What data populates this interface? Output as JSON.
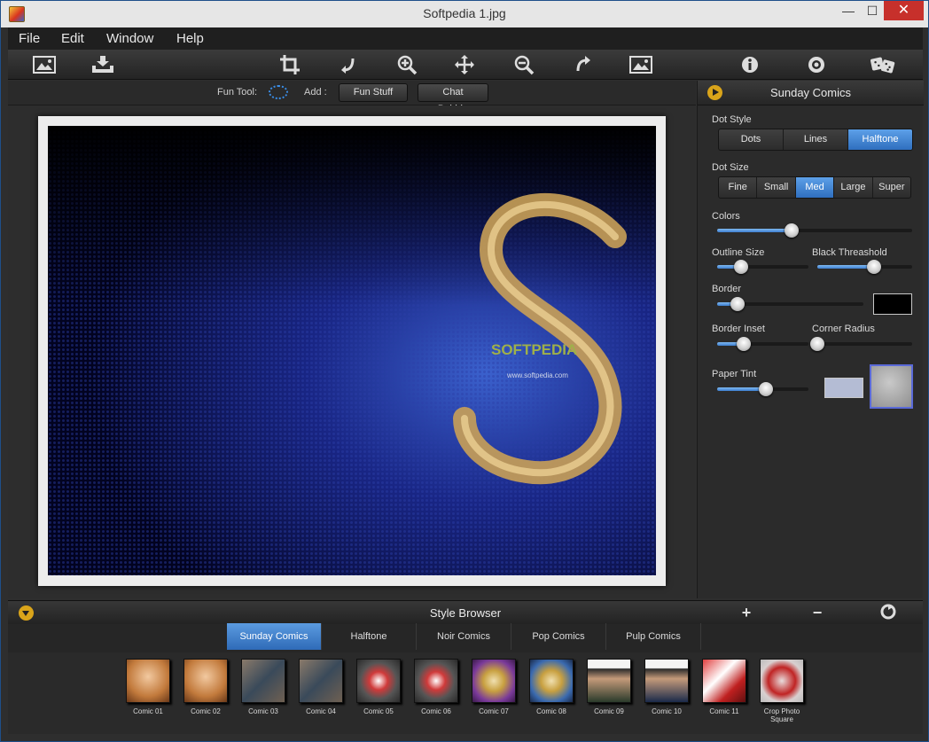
{
  "window": {
    "title": "Softpedia 1.jpg",
    "min": "—",
    "max": "☐",
    "close": "✕"
  },
  "menu": [
    "File",
    "Edit",
    "Window",
    "Help"
  ],
  "toolbar": {
    "icons": [
      "open-photo-icon",
      "save-icon",
      "crop-icon",
      "rotate-left-icon",
      "zoom-in-icon",
      "pan-icon",
      "zoom-out-icon",
      "rotate-right-icon",
      "fit-photo-icon",
      "info-icon",
      "settings-icon",
      "dice-icon"
    ]
  },
  "funbar": {
    "fun_tool_label": "Fun Tool:",
    "add_label": "Add :",
    "fun_stuff": "Fun Stuff",
    "chat_bubble": "Chat Bubble"
  },
  "panel": {
    "title": "Sunday Comics",
    "dot_style_label": "Dot Style",
    "dot_style_options": [
      "Dots",
      "Lines",
      "Halftone"
    ],
    "dot_style_selected": "Halftone",
    "dot_size_label": "Dot Size",
    "dot_size_options": [
      "Fine",
      "Small",
      "Med",
      "Large",
      "Super"
    ],
    "dot_size_selected": "Med",
    "colors_label": "Colors",
    "colors_value": 0.38,
    "outline_size_label": "Outline Size",
    "outline_size_value": 0.26,
    "black_threshold_label": "Black Threashold",
    "black_threshold_value": 0.6,
    "border_label": "Border",
    "border_value": 0.14,
    "border_color": "#000000",
    "border_inset_label": "Border Inset",
    "border_inset_value": 0.29,
    "corner_radius_label": "Corner Radius",
    "corner_radius_value": 0.0,
    "paper_tint_label": "Paper Tint",
    "paper_tint_value": 0.53,
    "paper_tint_color": "#b4bcd4"
  },
  "photo": {
    "watermark_title": "SOFTPEDIA",
    "watermark_sub": "www.softpedia.com"
  },
  "browser": {
    "title": "Style Browser",
    "add": "+",
    "remove": "−",
    "tabs": [
      "Sunday Comics",
      "Halftone",
      "Noir Comics",
      "Pop Comics",
      "Pulp Comics"
    ],
    "active_tab": "Sunday Comics",
    "thumbs": [
      "Comic 01",
      "Comic 02",
      "Comic 03",
      "Comic 04",
      "Comic 05",
      "Comic 06",
      "Comic 07",
      "Comic 08",
      "Comic 09",
      "Comic 10",
      "Comic 11",
      "Crop Photo Square"
    ]
  },
  "colors": {
    "accent": "#3d7fd0",
    "panel_bg": "#2b2b2b",
    "yellow": "#d9a41a"
  }
}
